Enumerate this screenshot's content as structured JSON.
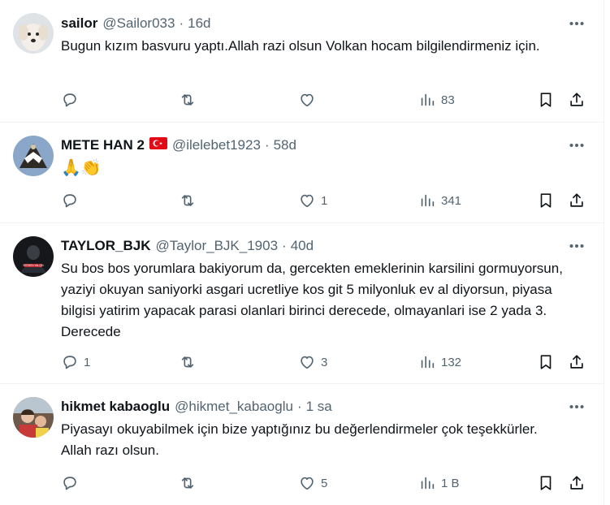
{
  "tweets": [
    {
      "name": "sailor",
      "handle": "@Sailor033",
      "sep": "·",
      "time": "16d",
      "text": "Bugun kızım basvuru yaptı.Allah razi olsun Volkan hocam bilgilendirmeniz için.",
      "replies": "",
      "retweets": "",
      "likes": "",
      "views": "83",
      "avatar_icon": "dog-avatar"
    },
    {
      "name": "METE HAN 2",
      "flag": "🇹🇷",
      "handle": "@ilelebet1923",
      "sep": "·",
      "time": "58d",
      "text": "🙏👏",
      "replies": "",
      "retweets": "",
      "likes": "1",
      "views": "341",
      "avatar_icon": "eagle-avatar"
    },
    {
      "name": "TAYLOR_BJK",
      "handle": "@Taylor_BJK_1903",
      "sep": "·",
      "time": "40d",
      "text": "Su bos bos yorumlara bakiyorum da, gercekten emeklerinin karsilini gormuyorsun, yaziyi okuyan saniyorki asgari ucretliye kos git 5 milyonluk ev al diyorsun, piyasa bilgisi yatirim yapacak parasi olanlari birinci derecede, olmayanlari ise 2 yada 3. Derecede",
      "avatar_text": "SERDEN YALÇIN",
      "replies": "1",
      "retweets": "",
      "likes": "3",
      "views": "132",
      "avatar_icon": "dark-portrait-avatar"
    },
    {
      "name": "hikmet kabaoglu",
      "handle": "@hikmet_kabaoglu",
      "sep": "·",
      "time": "1 sa",
      "text": "Piyasayı okuyabilmek için bize yaptığınız bu değerlendirmeler çok teşekkürler. Allah razı olsun.",
      "replies": "",
      "retweets": "",
      "likes": "5",
      "views": "1 B",
      "avatar_icon": "family-photo-avatar"
    }
  ],
  "colors": {
    "text": "#0f1419",
    "secondary": "#536471",
    "border": "#eff3f4",
    "flag_red": "#e30a17"
  }
}
